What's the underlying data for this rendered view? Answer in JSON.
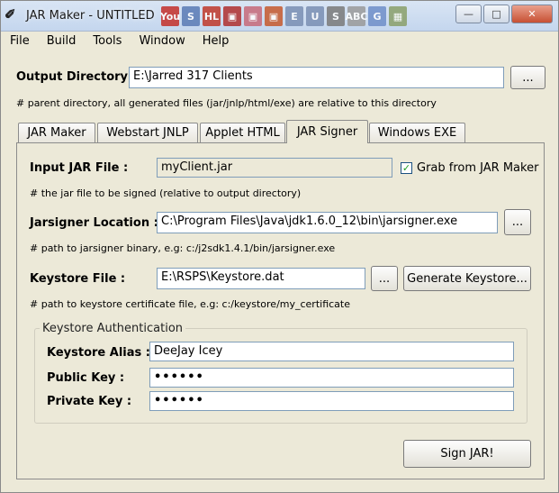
{
  "window": {
    "title": "JAR Maker - UNTITLED",
    "minimize_glyph": "—",
    "maximize_glyph": "□",
    "close_glyph": "✕"
  },
  "titlebar_icons": [
    {
      "name": "youtube-icon",
      "glyph": "You",
      "color": "#c4302b"
    },
    {
      "name": "s-icon",
      "glyph": "S",
      "color": "#5a7bb5"
    },
    {
      "name": "hl-icon",
      "glyph": "HL",
      "color": "#c0392b"
    },
    {
      "name": "red-app-icon",
      "glyph": "▣",
      "color": "#b03030"
    },
    {
      "name": "pink-app-icon",
      "glyph": "▣",
      "color": "#c76a7a"
    },
    {
      "name": "orange-app-icon",
      "glyph": "▣",
      "color": "#c65a2e"
    },
    {
      "name": "e-icon",
      "glyph": "E",
      "color": "#7a8fb3"
    },
    {
      "name": "u-icon",
      "glyph": "U",
      "color": "#7a8fb3"
    },
    {
      "name": "s2-icon",
      "glyph": "S",
      "color": "#7a7a7a"
    },
    {
      "name": "abc-icon",
      "glyph": "ABC",
      "color": "#9a9a9a"
    },
    {
      "name": "google-icon",
      "glyph": "G",
      "color": "#6f8fc9"
    },
    {
      "name": "grid-icon",
      "glyph": "▦",
      "color": "#8aa06a"
    }
  ],
  "menu": {
    "file": "File",
    "build": "Build",
    "tools": "Tools",
    "window": "Window",
    "help": "Help"
  },
  "output": {
    "label": "Output Directory :",
    "value": "E:\\Jarred 317 Clients",
    "browse": "...",
    "hint": "# parent directory, all generated files (jar/jnlp/html/exe) are relative to this directory"
  },
  "tabs": [
    {
      "label": "JAR Maker"
    },
    {
      "label": "Webstart JNLP"
    },
    {
      "label": "Applet HTML"
    },
    {
      "label": "JAR Signer"
    },
    {
      "label": "Windows EXE"
    }
  ],
  "signer": {
    "input_label": "Input JAR File :",
    "input_value": "myClient.jar",
    "grab_label": "Grab from JAR Maker",
    "grab_checked": true,
    "input_hint": "# the jar file to be signed (relative to output directory)",
    "jarsigner_label": "Jarsigner Location :",
    "jarsigner_value": "C:\\Program Files\\Java\\jdk1.6.0_12\\bin\\jarsigner.exe",
    "jarsigner_browse": "...",
    "jarsigner_hint": "# path to jarsigner binary, e.g: c:/j2sdk1.4.1/bin/jarsigner.exe",
    "keystore_label": "Keystore File :",
    "keystore_value": "E:\\RSPS\\Keystore.dat",
    "keystore_browse": "...",
    "generate_label": "Generate Keystore...",
    "keystore_hint": "# path to keystore certificate file, e.g: c:/keystore/my_certificate"
  },
  "auth": {
    "title": "Keystore Authentication",
    "alias_label": "Keystore Alias :",
    "alias_value": "DeeJay Icey",
    "public_label": "Public Key :",
    "public_value": "••••••",
    "private_label": "Private Key :",
    "private_value": "••••••"
  },
  "sign_button": "Sign JAR!"
}
